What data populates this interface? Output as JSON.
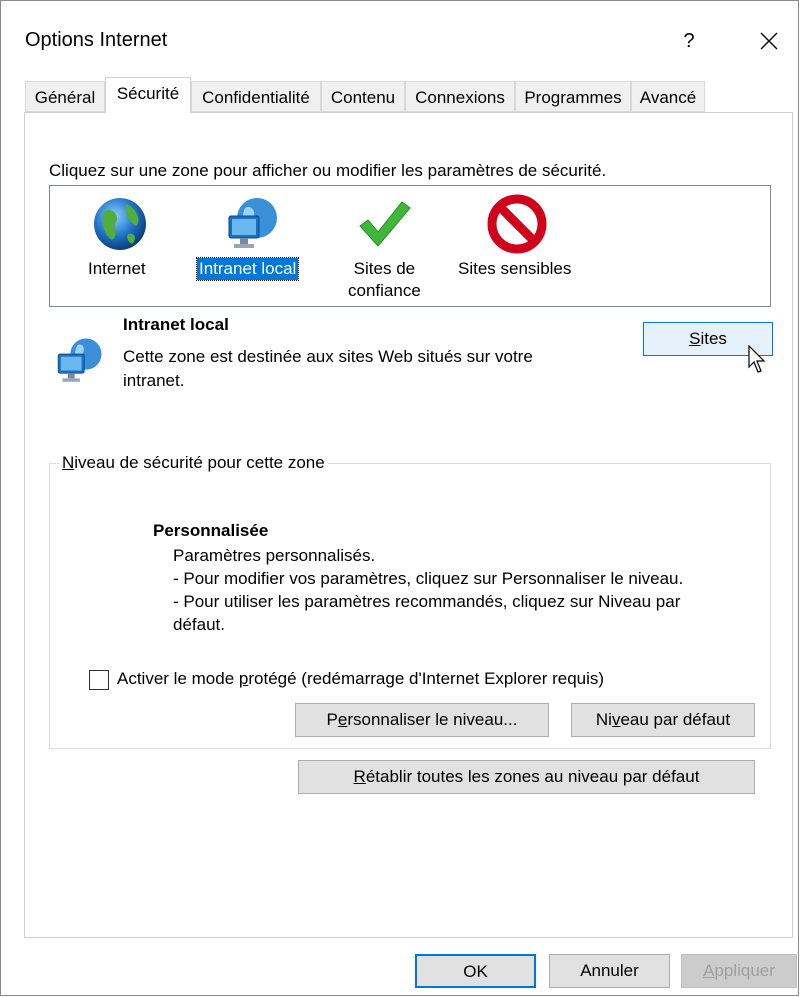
{
  "window": {
    "title": "Options Internet",
    "help_label": "?",
    "close_label": "×"
  },
  "tabs": [
    {
      "label": "Général"
    },
    {
      "label": "Sécurité"
    },
    {
      "label": "Confidentialité"
    },
    {
      "label": "Contenu"
    },
    {
      "label": "Connexions"
    },
    {
      "label": "Programmes"
    },
    {
      "label": "Avancé"
    }
  ],
  "active_tab": "Sécurité",
  "instruction": "Cliquez sur une zone pour afficher ou modifier les paramètres de sécurité.",
  "zones": [
    {
      "label": "Internet",
      "icon": "globe-icon"
    },
    {
      "label": "Intranet local",
      "icon": "intranet-globe-monitor-icon",
      "selected": true
    },
    {
      "label_line1": "Sites de",
      "label_line2": "confiance",
      "icon": "green-check-icon"
    },
    {
      "label": "Sites sensibles",
      "icon": "red-prohibited-icon"
    }
  ],
  "zone_info": {
    "title": "Intranet local",
    "description": "Cette zone est destinée aux sites Web situés sur votre intranet.",
    "sites_button": {
      "accel": "S",
      "rest": "ites"
    }
  },
  "security_level": {
    "legend_accel": "N",
    "legend_rest": "iveau de sécurité pour cette zone",
    "level_title": "Personnalisée",
    "lines": [
      "Paramètres personnalisés.",
      "- Pour modifier vos paramètres, cliquez sur Personnaliser le niveau.",
      "- Pour utiliser les paramètres recommandés, cliquez sur Niveau par",
      "défaut."
    ],
    "protected_mode": {
      "pre": "Activer le mode ",
      "accel": "p",
      "post": "rotégé (redémarrage d'Internet Explorer requis)",
      "checked": false
    },
    "customize_button": {
      "pre": "P",
      "accel": "e",
      "post": "rsonnaliser le niveau..."
    },
    "default_button": {
      "pre": "Ni",
      "accel": "v",
      "post": "eau par défaut"
    }
  },
  "reset_all_button": {
    "accel": "R",
    "rest": "établir toutes les zones au niveau par défaut"
  },
  "footer": {
    "ok": "OK",
    "cancel": "Annuler",
    "apply_accel": "A",
    "apply_rest": "ppliquer"
  },
  "colors": {
    "selection": "#0078d7",
    "dialog_bg": "#ffffff",
    "button_bg": "#e1e1e1"
  }
}
